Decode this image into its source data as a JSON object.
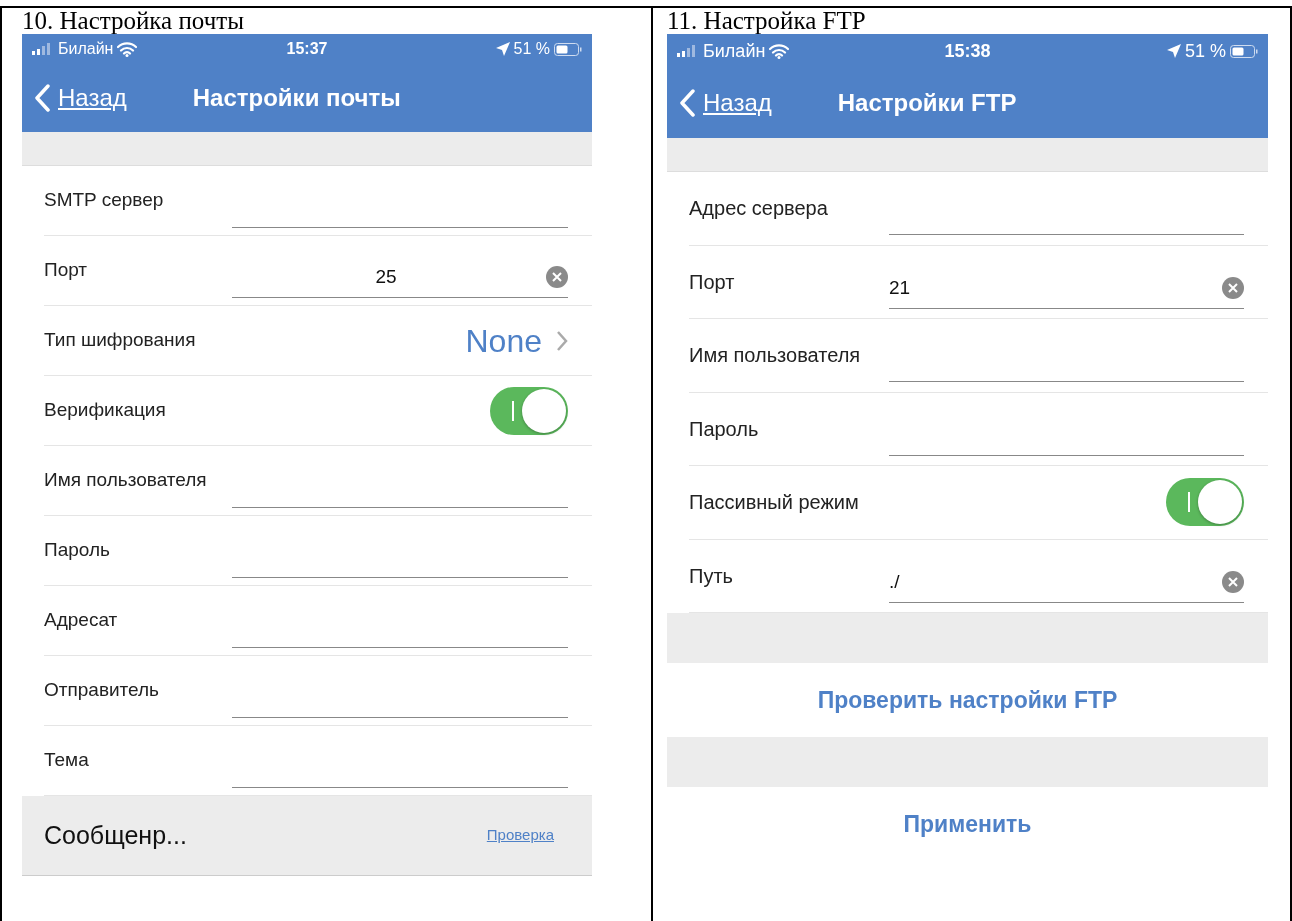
{
  "panels": [
    {
      "caption": "10. Настройка почты",
      "status_bar": {
        "carrier": "Билайн",
        "time": "15:37",
        "battery": "51 %"
      },
      "nav": {
        "back": "Назад",
        "title": "Настройки почты"
      },
      "rows": [
        {
          "kind": "field",
          "label": "SMTP сервер"
        },
        {
          "kind": "field",
          "label": "Порт",
          "value": "25",
          "centered": true,
          "clear": true
        },
        {
          "kind": "select",
          "label": "Тип шифрования",
          "value": "None"
        },
        {
          "kind": "toggle",
          "label": "Верификация",
          "on": true
        },
        {
          "kind": "field",
          "label": "Имя пользователя"
        },
        {
          "kind": "field",
          "label": "Пароль"
        },
        {
          "kind": "field",
          "label": "Адресат"
        },
        {
          "kind": "field",
          "label": "Отправитель"
        },
        {
          "kind": "field",
          "label": "Тема"
        }
      ],
      "actions": [
        {
          "kind": "message",
          "text": "Сообщенр...",
          "link": "Проверка"
        }
      ]
    },
    {
      "caption": "11. Настройка FTP",
      "status_bar": {
        "carrier": "Билайн",
        "time": "15:38",
        "battery": "51 %"
      },
      "nav": {
        "back": "Назад",
        "title": "Настройки FTP"
      },
      "rows": [
        {
          "kind": "field",
          "label": "Адрес сервера"
        },
        {
          "kind": "field",
          "label": "Порт",
          "value": "21",
          "clear": true
        },
        {
          "kind": "field",
          "label": "Имя пользователя"
        },
        {
          "kind": "field",
          "label": "Пароль"
        },
        {
          "kind": "toggle",
          "label": "Пассивный режим",
          "on": true
        },
        {
          "kind": "field",
          "label": "Путь",
          "value": "./",
          "clear": true
        }
      ],
      "actions": [
        {
          "kind": "button",
          "text": "Проверить настройки FTP"
        },
        {
          "kind": "button",
          "text": "Применить"
        }
      ]
    }
  ]
}
